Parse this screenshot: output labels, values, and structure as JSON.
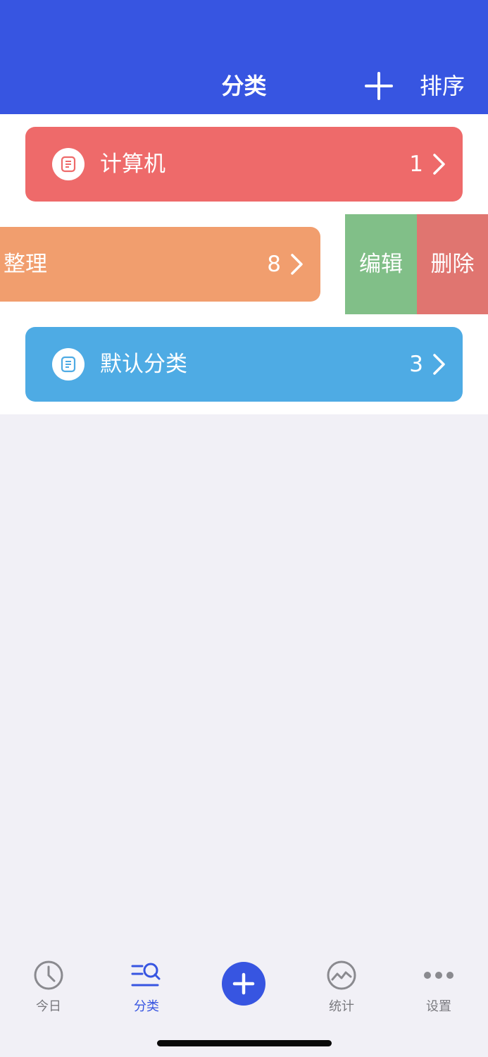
{
  "header": {
    "title": "分类",
    "sort_label": "排序",
    "add_icon": "plus-icon"
  },
  "categories": [
    {
      "name": "计算机",
      "count": "1",
      "color": "#ee6a6a",
      "icon": "list-doc-icon"
    },
    {
      "name": "整理",
      "count": "8",
      "color": "#f19e6e",
      "icon": "list-doc-icon",
      "swiped": true
    },
    {
      "name": "默认分类",
      "count": "3",
      "color": "#4eabe4",
      "icon": "list-doc-icon"
    }
  ],
  "swipe_actions": {
    "edit_label": "编辑",
    "edit_color": "#81bf88",
    "delete_label": "删除",
    "delete_color": "#e07570"
  },
  "tabbar": {
    "tabs": [
      {
        "label": "今日",
        "icon": "clock-icon"
      },
      {
        "label": "分类",
        "icon": "category-search-icon",
        "active": true
      },
      {
        "label": "",
        "icon": "plus-fab-icon"
      },
      {
        "label": "统计",
        "icon": "chart-trend-icon"
      },
      {
        "label": "设置",
        "icon": "more-dots-icon"
      }
    ],
    "accent": "#3755e1"
  }
}
